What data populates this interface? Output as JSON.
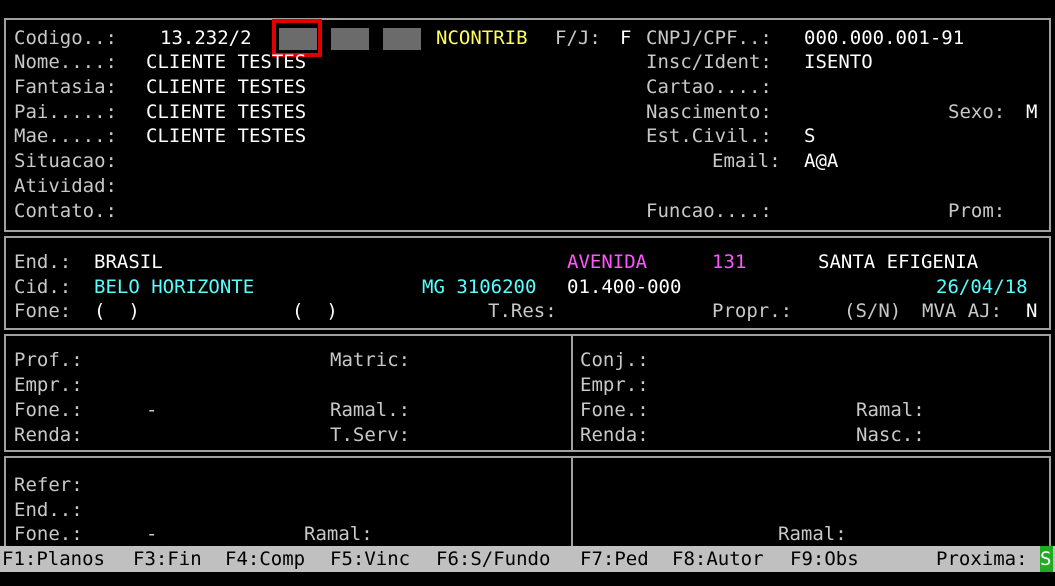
{
  "header": {
    "codigo_label": "Codigo..:",
    "codigo_value": "13.232/2",
    "ncontrib": "NCONTRIB",
    "fj_label": "F/J:",
    "fj_value": "F",
    "cnpj_label": "CNPJ/CPF..:",
    "cnpj_value": "000.000.001-91",
    "nome_label": "Nome....:",
    "nome_value": "CLIENTE TESTES",
    "insc_label": "Insc/Ident:",
    "insc_value": "ISENTO",
    "fantasia_label": "Fantasia:",
    "fantasia_value": "CLIENTE TESTES",
    "cartao_label": "Cartao....:",
    "pai_label": "Pai.....:",
    "pai_value": "CLIENTE TESTES",
    "nascimento_label": "Nascimento:",
    "sexo_label": "Sexo:",
    "sexo_value": "M",
    "mae_label": "Mae.....:",
    "mae_value": "CLIENTE TESTES",
    "estcivil_label": "Est.Civil.:",
    "estcivil_value": "S",
    "situacao_label": "Situacao:",
    "email_label": "Email:",
    "email_value": "A@A",
    "atividad_label": "Atividad:",
    "contato_label": "Contato.:",
    "funcao_label": "Funcao....:",
    "prom_label": "Prom:"
  },
  "address": {
    "end_label": "End.:",
    "end_value": "BRASIL",
    "street_type": "AVENIDA",
    "number": "131",
    "district": "SANTA EFIGENIA",
    "cid_label": "Cid.:",
    "city": "BELO HORIZONTE",
    "uf_code": "MG 3106200",
    "cep": "01.400-000",
    "date": "26/04/18",
    "fone_label": "Fone:",
    "fone1": "(  )",
    "fone2": "(  )",
    "tres_label": "T.Res:",
    "propr_label": "Propr.:",
    "sn_label": "(S/N)",
    "mva_label": "MVA AJ:",
    "mva_value": "N"
  },
  "work": {
    "prof_label": "Prof.:",
    "matric_label": "Matric:",
    "empr_label": "Empr.:",
    "fone_label": "Fone.:",
    "fone_dash": "-",
    "ramal_label": "Ramal.:",
    "renda_label": "Renda:",
    "tserv_label": "T.Serv:",
    "conj_label": "Conj.:",
    "conj_empr_label": "Empr.:",
    "conj_fone_label": "Fone.:",
    "conj_ramal_label": "Ramal:",
    "conj_renda_label": "Renda:",
    "conj_nasc_label": "Nasc.:"
  },
  "ref": {
    "refer_label": "Refer:",
    "end_label": "End..:",
    "fone_label": "Fone.:",
    "fone_dash": "-",
    "ramal_label": "Ramal:",
    "ramal2_label": "Ramal:"
  },
  "fkeys": {
    "f1": "F1:Planos",
    "f3": "F3:Fin",
    "f4": "F4:Comp",
    "f5": "F5:Vinc",
    "f6": "F6:S/Fundo",
    "f7": "F7:Ped",
    "f8": "F8:Autor",
    "f9": "F9:Obs",
    "proxima_label": "Proxima:",
    "proxima_value": "S"
  }
}
